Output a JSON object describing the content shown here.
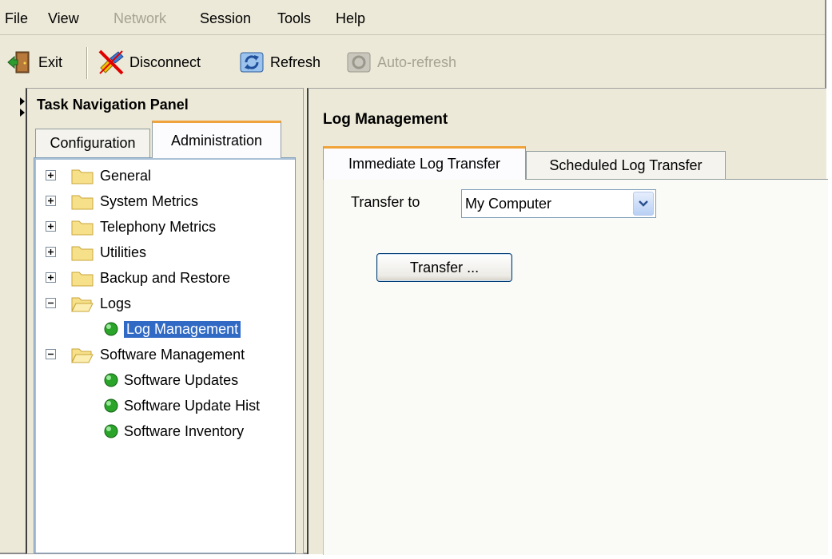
{
  "menu": {
    "items": [
      {
        "label": "File",
        "enabled": true
      },
      {
        "label": "View",
        "enabled": true
      },
      {
        "label": "Network",
        "enabled": false
      },
      {
        "label": "Session",
        "enabled": true
      },
      {
        "label": "Tools",
        "enabled": true
      },
      {
        "label": "Help",
        "enabled": true
      }
    ]
  },
  "toolbar": {
    "exit_label": "Exit",
    "disconnect_label": "Disconnect",
    "refresh_label": "Refresh",
    "autorefresh_label": "Auto-refresh"
  },
  "nav": {
    "title": "Task Navigation Panel",
    "tabs": [
      {
        "label": "Configuration",
        "active": false
      },
      {
        "label": "Administration",
        "active": true
      }
    ],
    "tree": [
      {
        "label": "General",
        "type": "folder",
        "expanded": false
      },
      {
        "label": "System Metrics",
        "type": "folder",
        "expanded": false
      },
      {
        "label": "Telephony Metrics",
        "type": "folder",
        "expanded": false
      },
      {
        "label": "Utilities",
        "type": "folder",
        "expanded": false
      },
      {
        "label": "Backup and Restore",
        "type": "folder",
        "expanded": false
      },
      {
        "label": "Logs",
        "type": "folder",
        "expanded": true
      },
      {
        "label": "Log Management",
        "type": "leaf",
        "selected": true
      },
      {
        "label": "Software Management",
        "type": "folder",
        "expanded": true
      },
      {
        "label": "Software Updates",
        "type": "leaf",
        "selected": false
      },
      {
        "label": "Software Update Hist",
        "type": "leaf",
        "selected": false
      },
      {
        "label": "Software Inventory",
        "type": "leaf",
        "selected": false
      }
    ]
  },
  "content": {
    "title": "Log Management",
    "tabs": [
      {
        "label": "Immediate Log Transfer",
        "active": true
      },
      {
        "label": "Scheduled Log Transfer",
        "active": false
      }
    ],
    "transfer_to_label": "Transfer to",
    "transfer_to_value": "My Computer",
    "transfer_button_label": "Transfer ..."
  },
  "colors": {
    "selection": "#316ac5",
    "tab_accent": "#f0a33a",
    "window_bg": "#ece9d8"
  }
}
